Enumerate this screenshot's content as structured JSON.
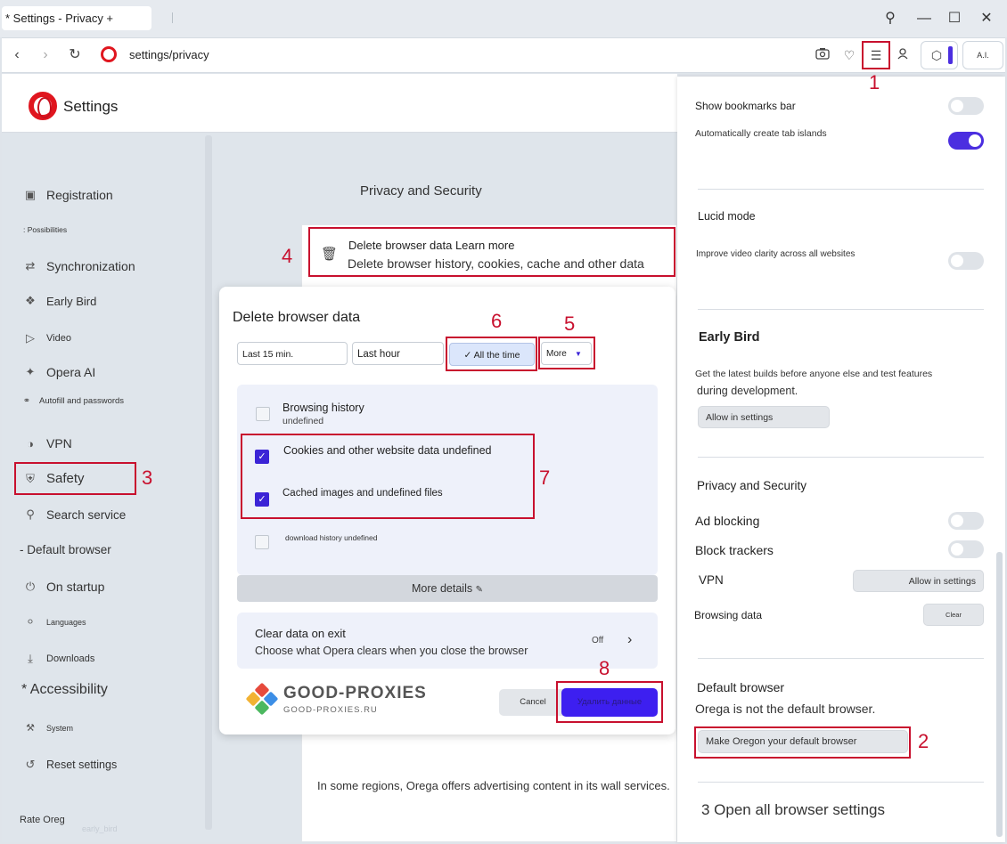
{
  "window": {
    "tab_title": "* Settings - Privacy +",
    "controls": [
      "search-icon",
      "minimize-icon",
      "maximize-icon",
      "close-icon"
    ]
  },
  "address_bar": {
    "url": "settings/privacy",
    "icons": [
      "back-icon",
      "forward-icon",
      "reload-icon",
      "opera-icon",
      "camera-icon",
      "heart-icon",
      "easy-setup-icon",
      "profile-icon",
      "cube-icon",
      "ai-icon"
    ],
    "ai_label": "A.I."
  },
  "header": {
    "title": "Settings"
  },
  "sidebar": {
    "items": [
      {
        "label": "Registration",
        "icon": "image-icon"
      },
      {
        "label": ": Possibilities",
        "icon": ""
      },
      {
        "label": "Synchronization",
        "icon": "sync-icon"
      },
      {
        "label": "Early Bird",
        "icon": "bird-icon"
      },
      {
        "label": "Video",
        "icon": "play-icon"
      },
      {
        "label": "Opera AI",
        "icon": "ai-icon"
      },
      {
        "label": "Autofill and passwords",
        "icon": "key-icon"
      },
      {
        "label": "VPN",
        "icon": "vpn-icon"
      },
      {
        "label": "Safety",
        "icon": "shield-icon"
      },
      {
        "label": "Search service",
        "icon": "search-icon"
      },
      {
        "label": "- Default browser",
        "icon": ""
      },
      {
        "label": "On startup",
        "icon": "power-icon"
      },
      {
        "label": "Languages",
        "icon": "globe-icon"
      },
      {
        "label": "Downloads",
        "icon": "download-icon"
      },
      {
        "label": "* Accessibility",
        "icon": ""
      },
      {
        "label": "System",
        "icon": "wrench-icon"
      },
      {
        "label": "Reset settings",
        "icon": "reset-icon"
      },
      {
        "label": "Rate Oreg",
        "icon": ""
      }
    ],
    "faded_text": "early_bird"
  },
  "main": {
    "section_heading": "Privacy and Security",
    "delete_row": {
      "title": "Delete browser data Learn more",
      "subtitle": "Delete browser history, cookies, cache and other data"
    },
    "bottom_text": "In some regions, Orega offers advertising content in its wall services."
  },
  "dialog": {
    "title": "Delete browser data",
    "ranges": [
      "Last 15 min.",
      "Last hour",
      "✓ All the time",
      "More"
    ],
    "options": [
      {
        "label": "Browsing history",
        "sub": "undefined",
        "checked": false
      },
      {
        "label": "Cookies and other website data undefined",
        "checked": true
      },
      {
        "label": "Cached images and undefined files",
        "checked": true
      },
      {
        "label": "download history undefined",
        "checked": false
      }
    ],
    "more_details": "More details",
    "clear_exit": {
      "title": "Clear data on exit",
      "sub": "Choose what Opera clears when you close the browser",
      "state": "Off"
    },
    "cancel": "Cancel",
    "confirm": "Удалить данные"
  },
  "watermark": {
    "brand": "GOOD-PROXIES",
    "url": "GOOD-PROXIES.RU"
  },
  "right_panel": {
    "show_bookmarks": {
      "label": "Show bookmarks bar",
      "on": false
    },
    "tab_islands": {
      "label": "Automatically create tab islands",
      "on": true
    },
    "lucid_mode": {
      "heading": "Lucid mode",
      "label": "Improve video clarity across all websites",
      "on": false
    },
    "early_bird": {
      "heading": "Early Bird",
      "desc1": "Get the latest builds before anyone else and test features",
      "desc2": "during development.",
      "button": "Allow in settings"
    },
    "privacy": {
      "heading": "Privacy and Security",
      "ad_blocking": {
        "label": "Ad blocking",
        "on": false
      },
      "block_trackers": {
        "label": "Block trackers",
        "on": false
      },
      "vpn": {
        "label": "VPN",
        "button": "Allow in settings"
      },
      "browsing_data": {
        "label": "Browsing data",
        "button": "Clear"
      }
    },
    "default_browser": {
      "heading": "Default browser",
      "status": "Orega is not the default browser.",
      "button": "Make Oregon your default browser"
    },
    "footer": "3 Open all browser settings"
  },
  "annotations": [
    "1",
    "2",
    "3",
    "4",
    "5",
    "6",
    "7",
    "8"
  ],
  "colors": {
    "accent": "#4b2ee0",
    "annotation": "#c8102e",
    "opera_red": "#e0161f"
  }
}
